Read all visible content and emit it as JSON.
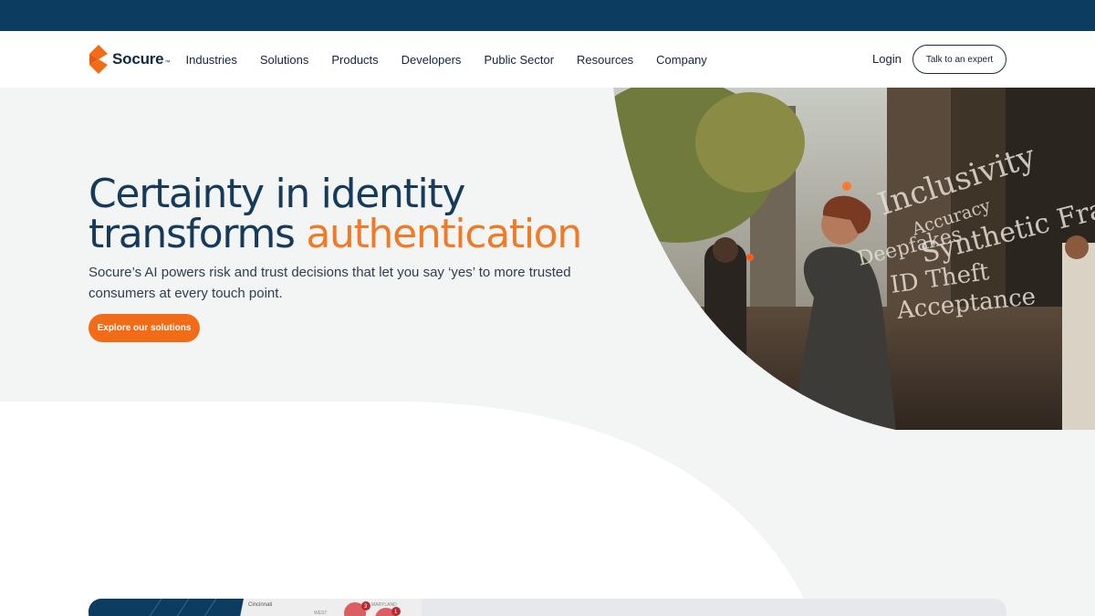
{
  "brand": {
    "name": "Socure",
    "trademark": "™",
    "colors": {
      "navy": "#0d3c61",
      "orange": "#f26c17",
      "accent_text": "#f07a26"
    }
  },
  "nav": {
    "items": [
      {
        "label": "Industries"
      },
      {
        "label": "Solutions"
      },
      {
        "label": "Products"
      },
      {
        "label": "Developers"
      },
      {
        "label": "Public Sector"
      },
      {
        "label": "Resources"
      },
      {
        "label": "Company"
      }
    ],
    "login_label": "Login",
    "cta_label": "Talk to an expert"
  },
  "hero": {
    "headline_line1": "Certainty in identity",
    "headline_line2_prefix": "transforms ",
    "headline_line2_accent": "authentication",
    "subtext": "Socure’s AI powers risk and trust decisions that let you say ‘yes’ to more trusted consumers at every touch point.",
    "cta_label": "Explore our solutions",
    "image_words": [
      "Inclusivity",
      "Accuracy",
      "Deepfakes",
      "Synthetic Frau",
      "ID Theft",
      "Acceptance"
    ]
  },
  "map_preview": {
    "labels": [
      "Cincinnati",
      "WEST",
      "MARYLAND"
    ],
    "badges": [
      "3",
      "1"
    ]
  }
}
